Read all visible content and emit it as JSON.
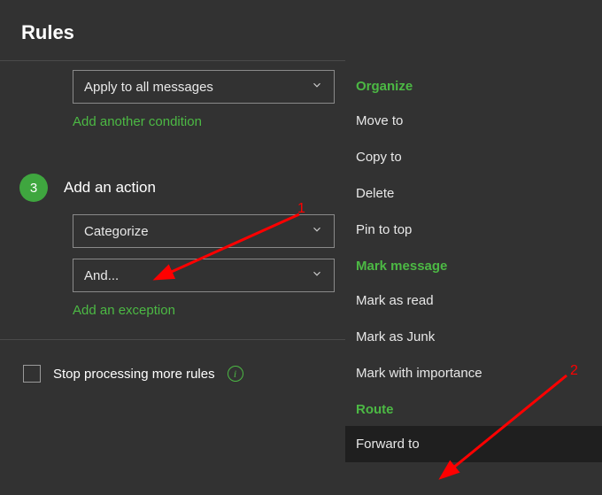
{
  "panel": {
    "title": "Rules"
  },
  "condition": {
    "select_value": "Apply to all messages",
    "add_link": "Add another condition"
  },
  "step3": {
    "number": "3",
    "title": "Add an action",
    "select1_value": "Categorize",
    "select2_value": "And...",
    "exception_link": "Add an exception"
  },
  "stop": {
    "label": "Stop processing more rules"
  },
  "menu": {
    "group1": "Organize",
    "item_move": "Move to",
    "item_copy": "Copy to",
    "item_delete": "Delete",
    "item_pin": "Pin to top",
    "group2": "Mark message",
    "item_read": "Mark as read",
    "item_junk": "Mark as Junk",
    "item_importance": "Mark with importance",
    "group3": "Route",
    "item_forward": "Forward to"
  },
  "annotations": {
    "one": "1",
    "two": "2"
  }
}
